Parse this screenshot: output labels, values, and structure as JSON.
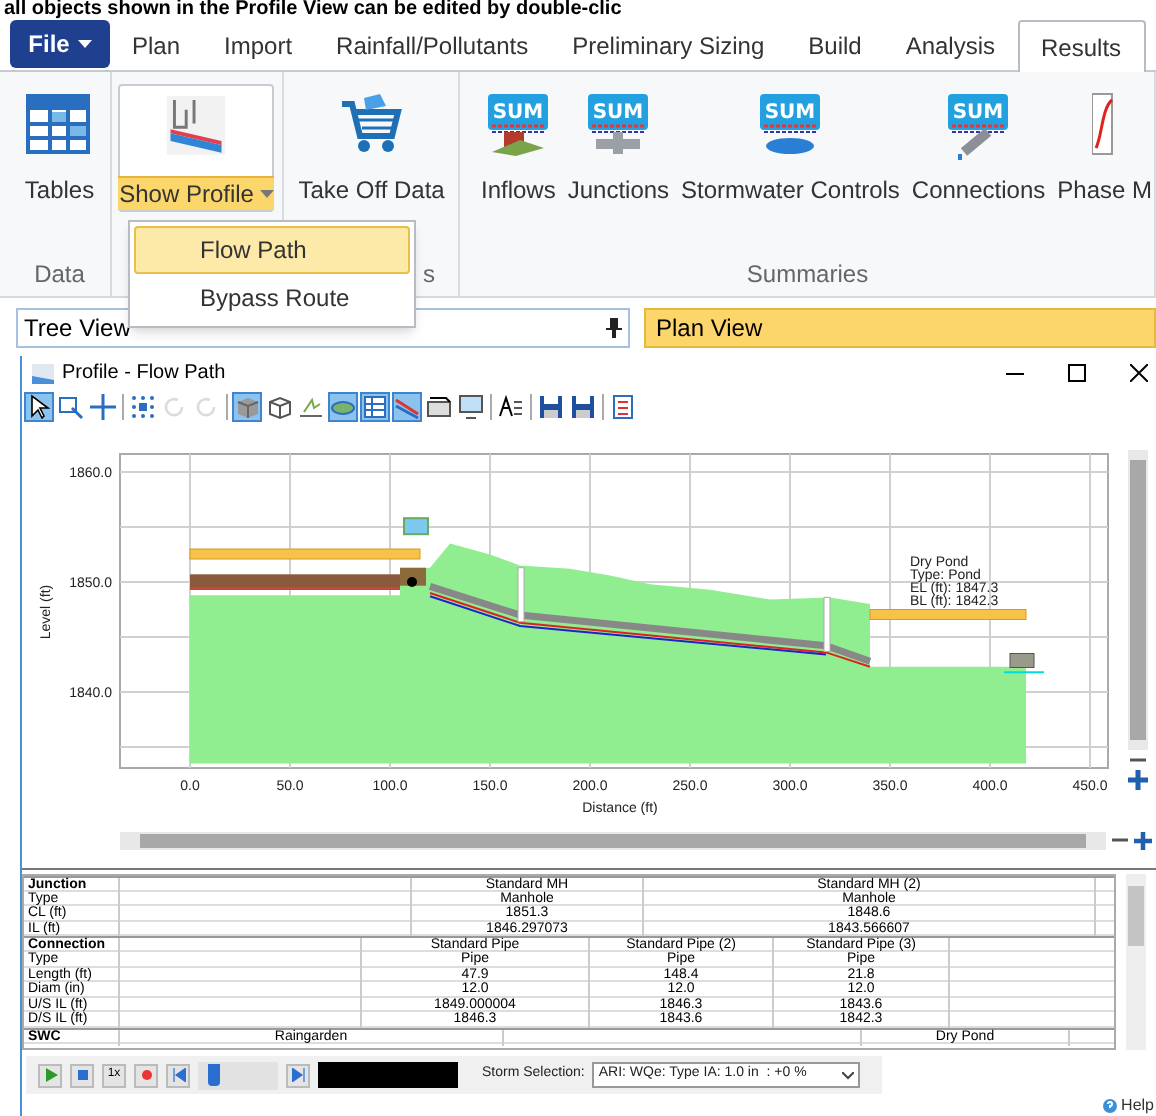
{
  "caption": "all objects shown in the Profile View can be edited by double-clic",
  "menu_tabs": [
    {
      "label": "File",
      "kind": "file",
      "selected": false
    },
    {
      "label": "Plan",
      "kind": "tab",
      "selected": false
    },
    {
      "label": "Import",
      "kind": "tab",
      "selected": false
    },
    {
      "label": "Rainfall/Pollutants",
      "kind": "tab",
      "selected": false
    },
    {
      "label": "Preliminary Sizing",
      "kind": "tab",
      "selected": false
    },
    {
      "label": "Build",
      "kind": "tab",
      "selected": false
    },
    {
      "label": "Analysis",
      "kind": "tab",
      "selected": false
    },
    {
      "label": "Results",
      "kind": "tab",
      "selected": true
    }
  ],
  "ribbon_groups": [
    {
      "label": "Data",
      "buttons": [
        {
          "label": "Tables",
          "kind": "tables",
          "open": false
        }
      ]
    },
    {
      "buttons": [
        {
          "label": "Show Profile",
          "kind": "profile",
          "open": true
        }
      ]
    },
    {
      "label": "s",
      "buttons": [
        {
          "label": "Take Off Data",
          "kind": "cart",
          "open": false
        }
      ]
    },
    {
      "label": "Summaries",
      "buttons": [
        {
          "label": "Inflows",
          "kind": "sum",
          "badge": "SUM",
          "open": false
        },
        {
          "label": "Junctions",
          "kind": "sum",
          "badge": "SUM",
          "open": false
        },
        {
          "label": "Stormwater Controls",
          "kind": "sum",
          "badge": "SUM",
          "open": false
        },
        {
          "label": "Connections",
          "kind": "sum",
          "badge": "SUM",
          "open": false
        },
        {
          "label": "Phase M",
          "kind": "phase",
          "open": false
        }
      ]
    }
  ],
  "profile_menu": [
    {
      "label": "Flow Path",
      "selected": true
    },
    {
      "label": "Bypass Route",
      "selected": false
    }
  ],
  "panels": [
    {
      "label": "Tree View",
      "kind": "tree"
    },
    {
      "label": "Plan View",
      "kind": "plan"
    }
  ],
  "profile_window": {
    "title": "Profile - Flow Path",
    "toolbar": [
      {
        "kind": "pointer",
        "selected": true,
        "disabled": false
      },
      {
        "kind": "zoom",
        "selected": false,
        "disabled": false
      },
      {
        "kind": "pan",
        "selected": false,
        "disabled": false
      },
      {
        "kind": "fit",
        "selected": false,
        "disabled": false
      },
      {
        "kind": "rotate",
        "selected": false,
        "disabled": true
      },
      {
        "kind": "rotate",
        "selected": false,
        "disabled": true
      },
      {
        "kind": "cube",
        "selected": true,
        "disabled": false
      },
      {
        "kind": "wire",
        "selected": false,
        "disabled": false
      },
      {
        "kind": "ground",
        "selected": false,
        "disabled": false
      },
      {
        "kind": "plan",
        "selected": true,
        "disabled": false
      },
      {
        "kind": "table",
        "selected": true,
        "disabled": false
      },
      {
        "kind": "slope",
        "selected": true,
        "disabled": false
      },
      {
        "kind": "export",
        "selected": false,
        "disabled": false
      },
      {
        "kind": "monitor",
        "selected": false,
        "disabled": false
      },
      {
        "kind": "text",
        "selected": false,
        "disabled": false
      },
      {
        "kind": "save",
        "selected": false,
        "disabled": false
      },
      {
        "kind": "save",
        "selected": false,
        "disabled": false
      },
      {
        "kind": "layout",
        "selected": false,
        "disabled": false
      }
    ],
    "y_ticks": [
      "1860.0",
      "1850.0",
      "1840.0"
    ],
    "x_ticks": [
      "0.0",
      "50.0",
      "100.0",
      "150.0",
      "200.0",
      "250.0",
      "300.0",
      "350.0",
      "400.0",
      "450.0"
    ],
    "xlabel": "Distance (ft)",
    "ylabel": "Level (ft)",
    "annotation": [
      "Dry Pond",
      "Type: Pond",
      "EL (ft): 1847.3",
      "BL (ft): 1842.3"
    ]
  },
  "results_table": [
    {
      "header": "Junction",
      "values": [
        "Standard MH",
        "Standard MH (2)"
      ],
      "rows": [
        {
          "label": "Type",
          "values": [
            "Manhole",
            "Manhole"
          ]
        },
        {
          "label": "CL (ft)",
          "values": [
            "1851.3",
            "1848.6"
          ]
        },
        {
          "label": "IL (ft)",
          "values": [
            "1846.297073",
            "1843.566607"
          ]
        }
      ]
    },
    {
      "header": "Connection",
      "values": [
        "Standard Pipe",
        "Standard Pipe (2)",
        "Standard Pipe (3)"
      ],
      "rows": [
        {
          "label": "Type",
          "values": [
            "Pipe",
            "Pipe",
            "Pipe"
          ]
        },
        {
          "label": "Length (ft)",
          "values": [
            "47.9",
            "148.4",
            "21.8"
          ]
        },
        {
          "label": "Diam (in)",
          "values": [
            "12.0",
            "12.0",
            "12.0"
          ]
        },
        {
          "label": "U/S IL (ft)",
          "values": [
            "1849.000004",
            "1846.3",
            "1843.6"
          ]
        },
        {
          "label": "D/S IL (ft)",
          "values": [
            "1846.3",
            "1843.6",
            "1842.3"
          ]
        }
      ]
    },
    {
      "header": "SWC",
      "values": [
        "Raingarden",
        "Dry Pond"
      ]
    }
  ],
  "player": {
    "speed": "1x",
    "level": 0.15,
    "storm_label": "Storm Selection:",
    "storm_value": "ARI: WQe: Type IA: 1.0 in  : +0 %"
  },
  "help": "Help"
}
